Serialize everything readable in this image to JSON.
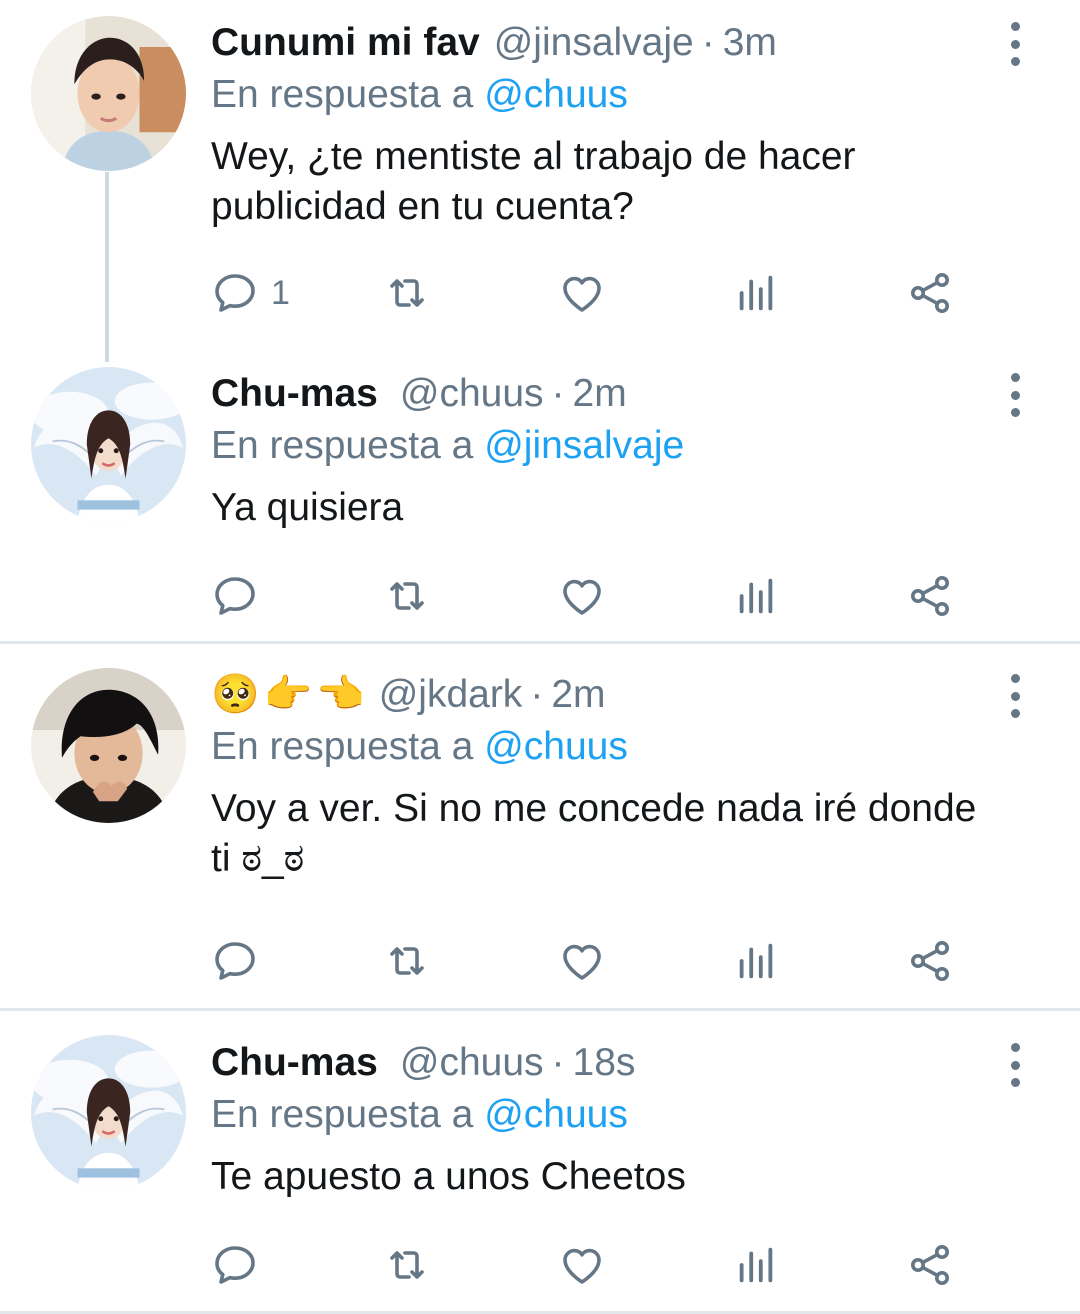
{
  "tweets": [
    {
      "name": "Cunumi mi fav",
      "handle": "@jinsalvaje",
      "dot": "·",
      "time": "3m",
      "reply_prefix": "En respuesta a",
      "reply_to": "@chuus",
      "text": "Wey, ¿te mentiste al trabajo de hacer publicidad en tu cuenta?",
      "reply_count": "1",
      "avatar": "young-man-photo"
    },
    {
      "name": "Chu-mas",
      "handle": "@chuus",
      "dot": "·",
      "time": "2m",
      "reply_prefix": "En respuesta a",
      "reply_to": "@jinsalvaje",
      "text": "Ya quisiera",
      "reply_count": "",
      "avatar": "angel-wings-girl-photo"
    },
    {
      "name_emojis": [
        "🥺",
        "👉",
        "👈"
      ],
      "handle": "@jkdark",
      "dot": "·",
      "time": "2m",
      "reply_prefix": "En respuesta a",
      "reply_to": "@chuus",
      "text": "Voy a ver. Si no me concede nada iré donde ti ಠ_ಠ",
      "reply_count": "",
      "avatar": "dark-hair-man-photo"
    },
    {
      "name": "Chu-mas",
      "handle": "@chuus",
      "dot": "·",
      "time": "18s",
      "reply_prefix": "En respuesta a",
      "reply_to": "@chuus",
      "text": "Te apuesto a unos Cheetos",
      "reply_count": "",
      "avatar": "angel-wings-girl-photo"
    }
  ],
  "icons": {
    "reply": "reply-icon",
    "retweet": "retweet-icon",
    "like": "heart-icon",
    "analytics": "analytics-icon",
    "share": "share-icon",
    "more": "more-vertical-icon"
  },
  "colors": {
    "text": "#14171a",
    "secondary": "#657786",
    "link": "#1da1f2",
    "divider": "#e1e8ed",
    "thread_line": "#cfd9de"
  }
}
